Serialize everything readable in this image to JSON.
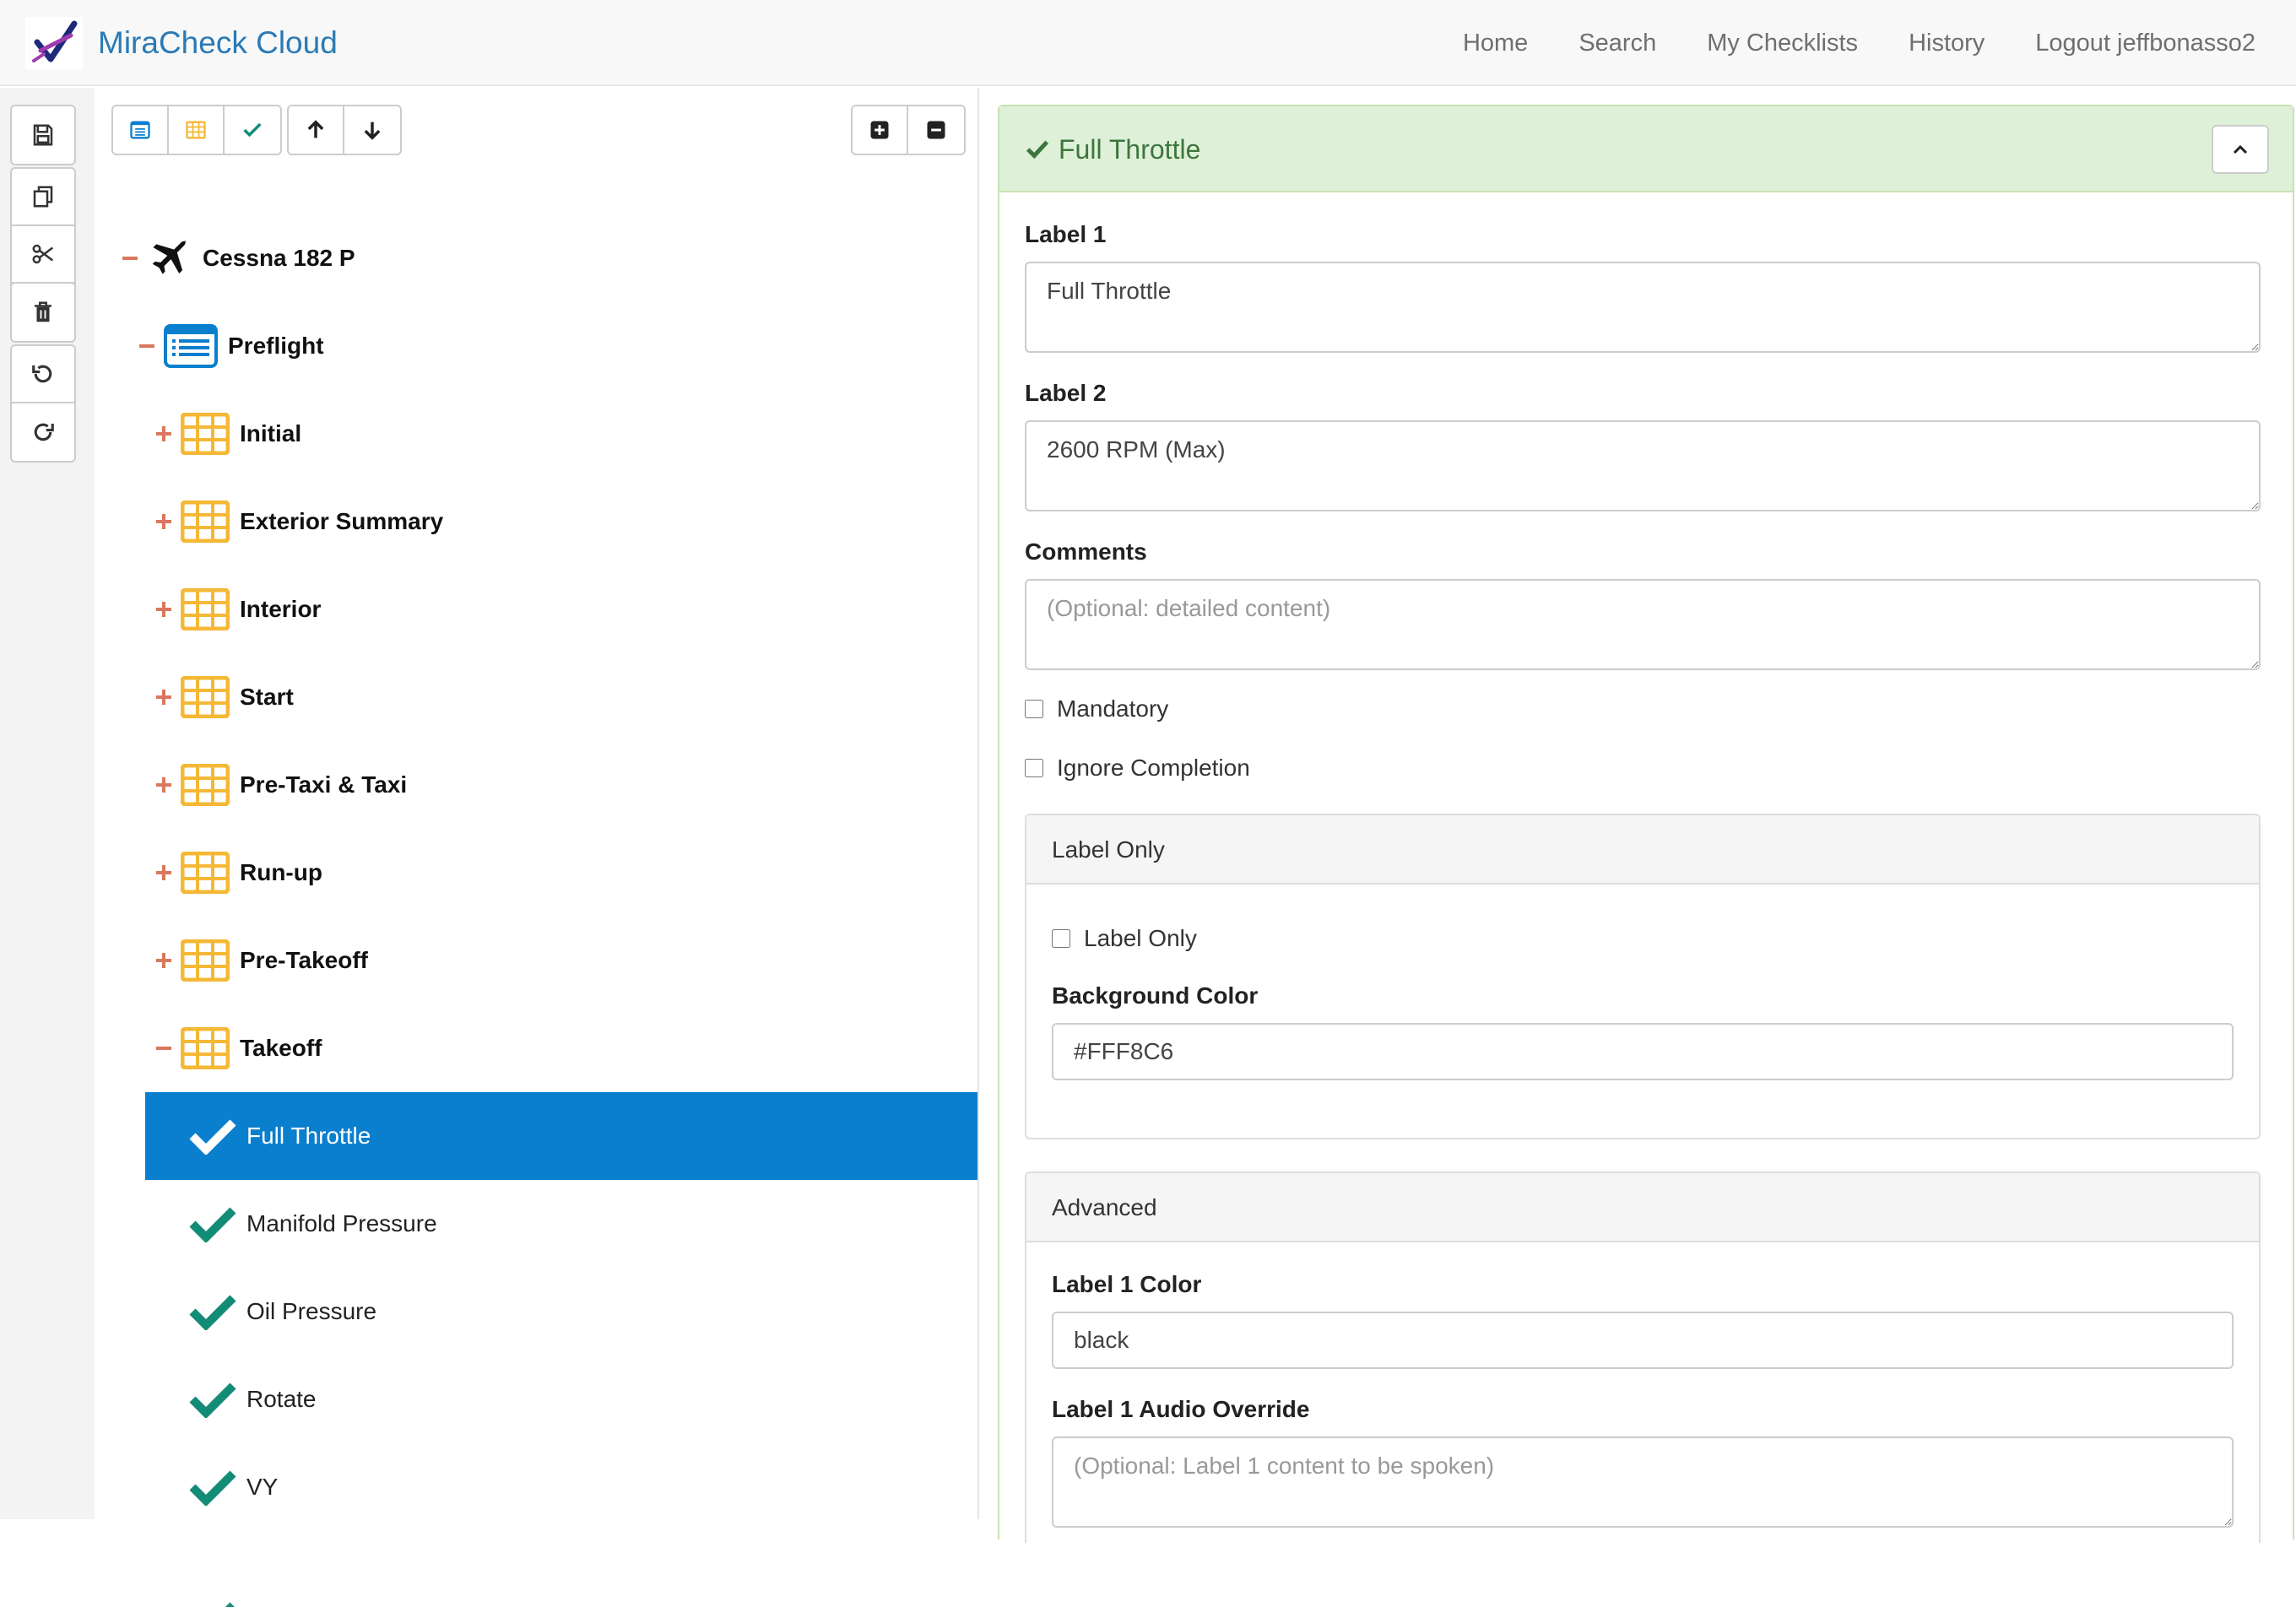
{
  "app": {
    "brand": "MiraCheck Cloud"
  },
  "nav": {
    "home": "Home",
    "search": "Search",
    "my_checklists": "My Checklists",
    "history": "History",
    "logout": "Logout jeffbonasso2"
  },
  "toolbar": {
    "icons": [
      "save-icon",
      "copy-icon",
      "cut-icon",
      "paste-icon",
      "trash-icon",
      "undo-icon",
      "redo-icon"
    ]
  },
  "tree": {
    "root": "Cessna 182 P",
    "checklist": "Preflight",
    "sections": [
      "Initial",
      "Exterior Summary",
      "Interior",
      "Start",
      "Pre-Taxi & Taxi",
      "Run-up",
      "Pre-Takeoff",
      "Takeoff"
    ],
    "items": [
      "Full Throttle",
      "Manifold Pressure",
      "Oil Pressure",
      "Rotate",
      "VY"
    ]
  },
  "colors": {
    "accent": "#0A7FCE",
    "success": "#3C763D",
    "check_teal": "#138C76",
    "section_yellow": "#F5B836",
    "collapse_red": "#D9785E",
    "brand_blue": "#2A7AB5"
  },
  "detail": {
    "title": "Full Throttle",
    "label1_label": "Label 1",
    "label1_value": "Full Throttle",
    "label2_label": "Label 2",
    "label2_value": "2600 RPM (Max)",
    "comments_label": "Comments",
    "comments_placeholder": "(Optional: detailed content)",
    "mandatory_label": "Mandatory",
    "ignore_label": "Ignore Completion",
    "label_only_section": {
      "title": "Label Only",
      "checkbox_label": "Label Only",
      "bg_color_label": "Background Color",
      "bg_color_value": "#FFF8C6"
    },
    "advanced_section": {
      "title": "Advanced",
      "label1_color_label": "Label 1 Color",
      "label1_color_value": "black",
      "label1_audio_label": "Label 1 Audio Override",
      "label1_audio_placeholder": "(Optional: Label 1 content to be spoken)"
    }
  }
}
